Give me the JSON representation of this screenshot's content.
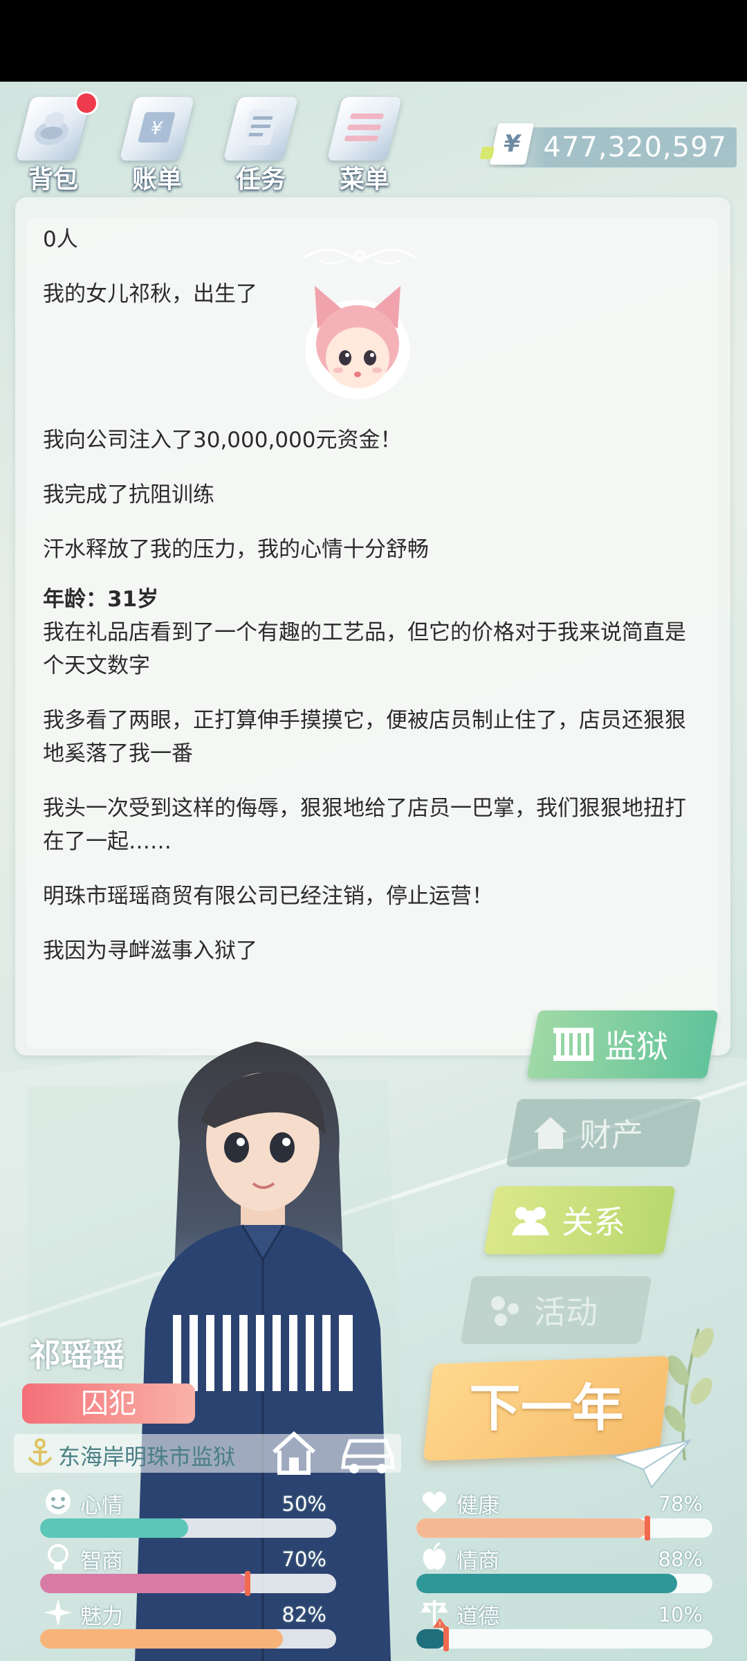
{
  "toolbar": {
    "items": [
      {
        "label": "背包",
        "icon": "backpack-icon"
      },
      {
        "label": "账单",
        "icon": "bill-icon"
      },
      {
        "label": "任务",
        "icon": "task-icon"
      },
      {
        "label": "菜单",
        "icon": "menu-icon"
      }
    ],
    "money": "477,320,597",
    "currency_symbol": "¥"
  },
  "log": {
    "entries_before_age": [
      "0人",
      "我的女儿祁秋，出生了"
    ],
    "entries_mid": [
      "我向公司注入了30,000,000元资金！",
      "我完成了抗阻训练",
      "汗水释放了我的压力，我的心情十分舒畅"
    ],
    "age_label": "年龄：31岁",
    "entries_after_age": [
      "我在礼品店看到了一个有趣的工艺品，但它的价格对于我来说简直是个天文数字",
      "我多看了两眼，正打算伸手摸摸它，便被店员制止住了，店员还狠狠地奚落了我一番",
      "我头一次受到这样的侮辱，狠狠地给了店员一巴掌，我们狠狠地扭打在了一起……",
      "明珠市瑶瑶商贸有限公司已经注销，停止运营！",
      "我因为寻衅滋事入狱了"
    ]
  },
  "side_menu": {
    "prison": "监狱",
    "assets": "财产",
    "relations": "关系",
    "activities": "活动"
  },
  "next_year_label": "下一年",
  "character": {
    "name": "祁瑶瑶",
    "job": "囚犯",
    "location": "东海岸明珠市监狱"
  },
  "stats": [
    {
      "name": "心情",
      "value": "50%",
      "fraction": 0.5,
      "color": "#5cc6b9",
      "icon": "smile-icon"
    },
    {
      "name": "健康",
      "value": "78%",
      "fraction": 0.78,
      "color": "#f6b894",
      "icon": "heart-icon"
    },
    {
      "name": "智商",
      "value": "70%",
      "fraction": 0.7,
      "color": "#d77ba6",
      "icon": "bulb-icon"
    },
    {
      "name": "情商",
      "value": "88%",
      "fraction": 0.88,
      "color": "#2f9797",
      "icon": "apple-icon"
    },
    {
      "name": "魅力",
      "value": "82%",
      "fraction": 0.82,
      "color": "#f7b47a",
      "icon": "sparkle-icon"
    },
    {
      "name": "道德",
      "value": "10%",
      "fraction": 0.1,
      "color": "#1f6f7d",
      "icon": "scales-icon"
    }
  ]
}
